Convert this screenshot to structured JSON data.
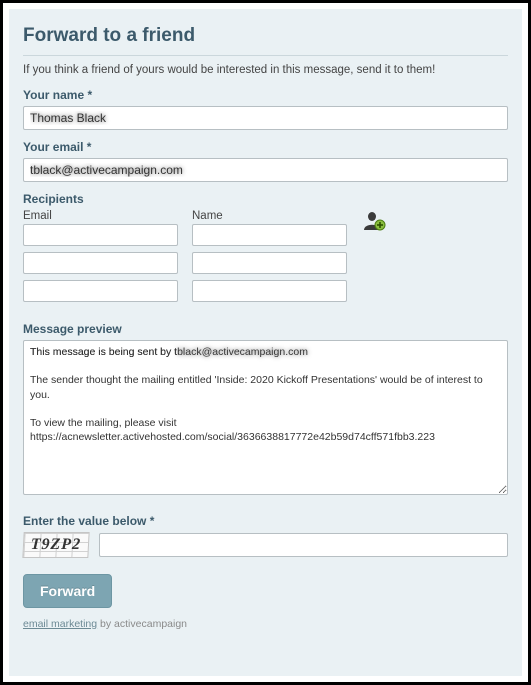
{
  "header": {
    "title": "Forward to a friend"
  },
  "intro": "If you think a friend of yours would be interested in this message, send it to them!",
  "your_name": {
    "label": "Your name *",
    "value": "Thomas Black"
  },
  "your_email": {
    "label": "Your email *",
    "value": "tblack@activecampaign.com"
  },
  "recipients": {
    "label": "Recipients",
    "email_label": "Email",
    "name_label": "Name",
    "rows": [
      {
        "email": "",
        "name": ""
      },
      {
        "email": "",
        "name": ""
      },
      {
        "email": "",
        "name": ""
      }
    ]
  },
  "message_preview": {
    "label": "Message preview",
    "sent_by_prefix": "This message is being sent by t",
    "sent_by_blurred": "black@activecampaign.com",
    "body_rest": "\nThe sender thought the mailing entitled 'Inside: 2020 Kickoff Presentations' would be of interest to you.\n\nTo view the mailing, please visit\nhttps://acnewsletter.activehosted.com/social/3636638817772e42b59d74cff571fbb3.223"
  },
  "captcha": {
    "label": "Enter the value below *",
    "image_text": "T9ZP2",
    "value": ""
  },
  "submit": {
    "label": "Forward"
  },
  "footer": {
    "link_text": "email marketing",
    "suffix": " by activecampaign"
  }
}
